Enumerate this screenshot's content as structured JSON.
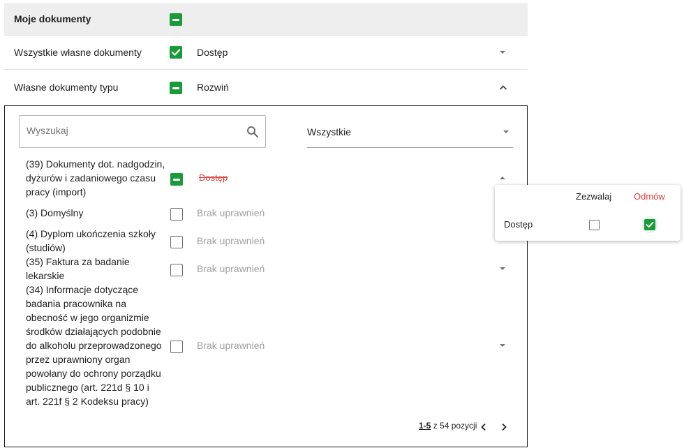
{
  "header": {
    "title": "Moje dokumenty"
  },
  "rows": {
    "all_own": {
      "label": "Wszystkie własne dokumenty",
      "value": "Dostęp"
    },
    "by_type": {
      "label": "Własne dokumenty typu",
      "value": "Rozwiń"
    }
  },
  "filter": {
    "search_placeholder": "Wyszukaj",
    "type_select_value": "Wszystkie"
  },
  "documents": [
    {
      "name": "(39) Dokumenty dot. nadgodzin, dyżurów i zadaniowego czasu pracy (import)",
      "status": "Dostęp",
      "status_style": "denied-strikethrough",
      "checkbox": "indeterminate",
      "expanded": true
    },
    {
      "name": "(3) Domyślny",
      "status": "Brak uprawnień",
      "checkbox": "unchecked"
    },
    {
      "name": "(4) Dyplom ukończenia szkoły (studiów)",
      "status": "Brak uprawnień",
      "checkbox": "unchecked"
    },
    {
      "name": "(35) Faktura za badanie lekarskie",
      "status": "Brak uprawnień",
      "checkbox": "unchecked"
    },
    {
      "name": "(34) Informacje dotyczące badania pracownika na obecność w jego organizmie środków działających podobnie do alkoholu przeprowadzonego przez uprawniony organ powołany do ochrony porządku publicznego (art. 221d § 10 i art. 221f § 2 Kodeksu pracy)",
      "status": "Brak uprawnień",
      "checkbox": "unchecked"
    }
  ],
  "popup": {
    "allow_header": "Zezwalaj",
    "deny_header": "Odmów",
    "permission_label": "Dostęp",
    "allow_checked": false,
    "deny_checked": true
  },
  "pagination": {
    "range": "1-5",
    "suffix": "z 54 pozycji"
  },
  "colors": {
    "green": "#1a9a3a",
    "deny_red": "#e53935",
    "header_bg": "#eeeeee",
    "muted_text": "#9e9e9e"
  },
  "icons": [
    "minus-checkbox-icon",
    "check-checkbox-icon",
    "chevron-down-icon",
    "chevron-up-icon",
    "search-icon",
    "chevron-left-icon",
    "chevron-right-icon"
  ]
}
